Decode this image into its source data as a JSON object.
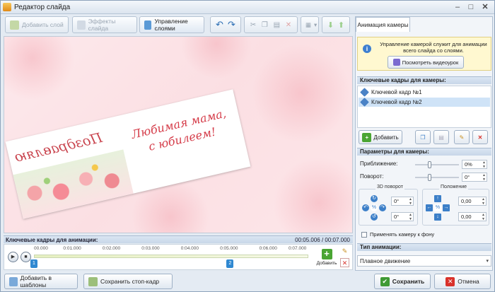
{
  "window": {
    "title": "Редактор слайда"
  },
  "toolbar": {
    "add_layer": "Добавить слой",
    "slide_effects": "Эффекты слайда",
    "manage_layers": "Управление слоями"
  },
  "slide": {
    "mirror_text": "Поздравляю",
    "greeting_line1": "Любимая мама,",
    "greeting_line2": "с юбилеем!"
  },
  "animation_keyframes": {
    "header": "Ключевые кадры для анимации:",
    "time": "00:05.006 / 00:07.000",
    "ticks": [
      "00.000",
      "0:01.000",
      "0:02.000",
      "0:03.000",
      "0:04.000",
      "0:05.000",
      "0:06.000",
      "0:07.000"
    ],
    "marker1": "1",
    "marker2": "2",
    "play_progress": 0.715,
    "add_label": "Добавить"
  },
  "bottom": {
    "add_templates": "Добавить в шаблоны",
    "save_frame": "Сохранить стоп-кадр",
    "save": "Сохранить",
    "cancel": "Отмена"
  },
  "panel": {
    "tab": "Анимация камеры",
    "info_text": "Управление камерой служит для анимации всего слайда со слоями.",
    "video_button": "Посмотреть видеоурок",
    "keyframes_header": "Ключевые кадры для камеры:",
    "keyframes": [
      "Ключевой кадр №1",
      "Ключевой кадр №2"
    ],
    "add_button": "Добавить",
    "params_header": "Параметры для камеры:",
    "zoom_label": "Приближение:",
    "zoom_value": "0%",
    "rotate_label": "Поворот:",
    "rotate_value": "0°",
    "rotate3d_title": "3D поворот",
    "position_title": "Положение",
    "rot3d_x": "0°",
    "rot3d_y": "0°",
    "pos_x": "0,00",
    "pos_y": "0,00",
    "apply_bg": "Применять камеру к фону",
    "anim_type_header": "Тип анимации:",
    "anim_type_value": "Плавное движение"
  },
  "colors": {
    "accent": "#2f88d1",
    "add_green": "#4aa533",
    "delete_red": "#d9322b"
  }
}
